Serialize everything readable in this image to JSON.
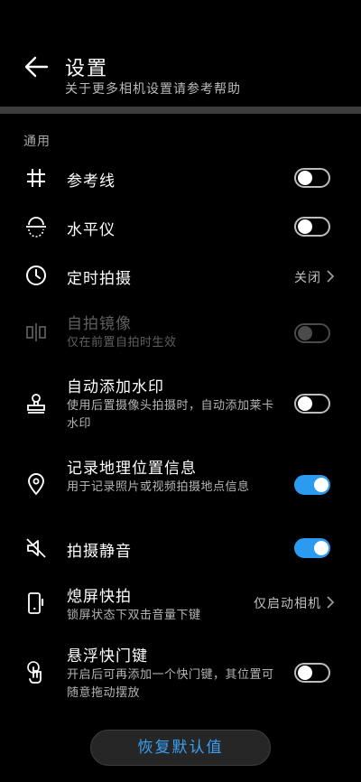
{
  "header": {
    "title": "设置",
    "cut_text": "关于更多相机设置请参考帮助"
  },
  "section": {
    "label": "通用"
  },
  "rows": [
    {
      "label": "参考线",
      "toggle": "off"
    },
    {
      "label": "水平仪",
      "toggle": "off"
    },
    {
      "label": "定时拍摄",
      "value": "关闭"
    },
    {
      "label": "自拍镜像",
      "sub": "仅在前置自拍时生效",
      "toggle": "disabled"
    },
    {
      "label": "自动添加水印",
      "sub": "使用后置摄像头拍摄时，自动添加莱卡水印",
      "toggle": "off"
    },
    {
      "label": "记录地理位置信息",
      "sub": "用于记录照片或视频拍摄地点信息",
      "toggle": "on"
    },
    {
      "label": "拍摄静音",
      "toggle": "on"
    },
    {
      "label": "熄屏快拍",
      "sub": "锁屏状态下双击音量下键",
      "value": "仅启动相机"
    },
    {
      "label": "悬浮快门键",
      "sub": "开启后可再添加一个快门键，其位置可随意拖动摆放",
      "toggle": "off"
    }
  ],
  "reset_button": {
    "label": "恢复默认值"
  },
  "colors": {
    "accent": "#2a9bf0",
    "background": "#000000"
  },
  "icons": [
    "back-arrow-icon",
    "grid-icon",
    "level-icon",
    "timer-icon",
    "mirror-icon",
    "watermark-icon",
    "location-pin-icon",
    "mute-icon",
    "screen-off-capture-icon",
    "floating-shutter-icon",
    "chevron-right-icon"
  ]
}
